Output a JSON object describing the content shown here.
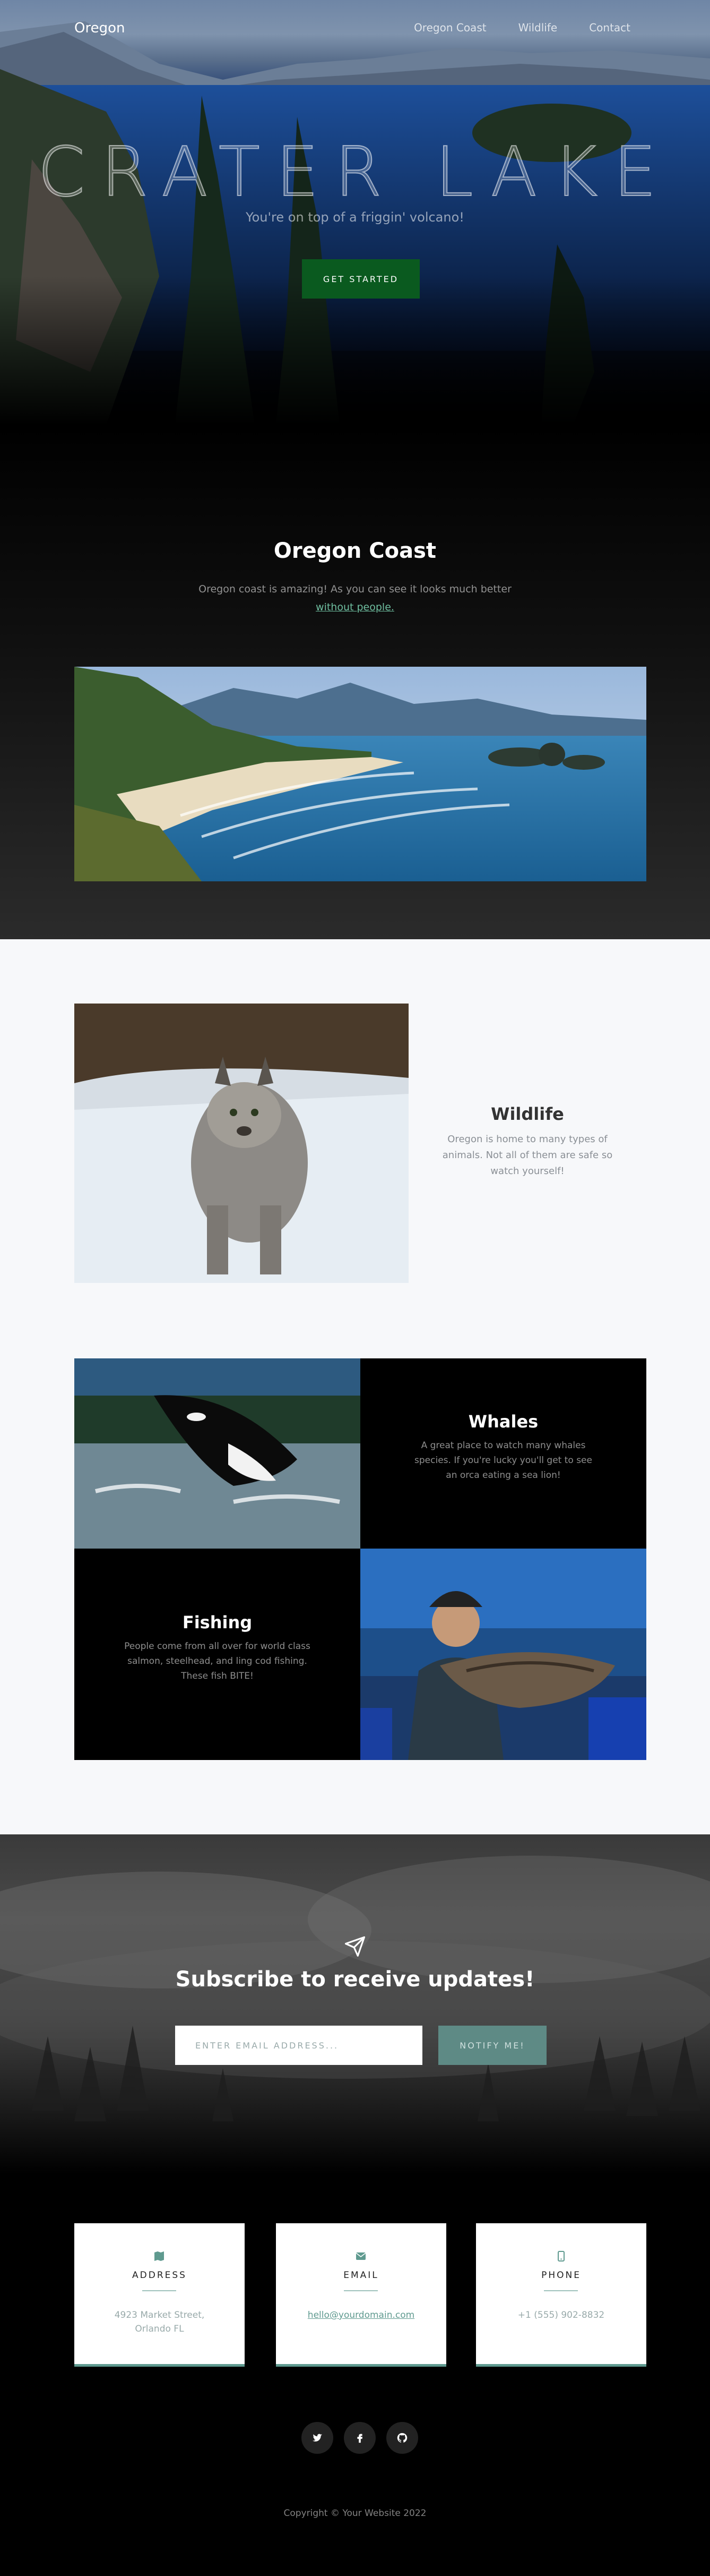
{
  "nav": {
    "brand": "Oregon",
    "links": [
      "Oregon Coast",
      "Wildlife",
      "Contact"
    ]
  },
  "hero": {
    "title": "CRATER LAKE",
    "subtitle": "You're on top of a friggin' volcano!",
    "button": "GET STARTED"
  },
  "coast": {
    "title": "Oregon Coast",
    "text": "Oregon coast is amazing! As you can see it looks much better",
    "link": "without people."
  },
  "wildlife": {
    "title": "Wildlife",
    "text": "Oregon is home to many types of animals. Not all of them are safe so watch yourself!"
  },
  "whales": {
    "title": "Whales",
    "text": "A great place to watch many whales species. If you're lucky you'll get to see an orca eating a sea lion!"
  },
  "fishing": {
    "title": "Fishing",
    "text": "People come from all over for world class salmon, steelhead, and ling cod fishing. These fish BITE!"
  },
  "subscribe": {
    "title": "Subscribe to receive updates!",
    "placeholder": "ENTER EMAIL ADDRESS...",
    "button": "NOTIFY ME!"
  },
  "contact": {
    "address_label": "ADDRESS",
    "address_value": "4923 Market Street, Orlando FL",
    "email_label": "EMAIL",
    "email_value": "hello@yourdomain.com",
    "phone_label": "PHONE",
    "phone_value": "+1 (555) 902-8832"
  },
  "footer": {
    "copyright": "Copyright © Your Website 2022"
  },
  "colors": {
    "accent": "#5f9a8f",
    "start_button": "#0a5a1f",
    "notify_button": "#5e8a85"
  }
}
